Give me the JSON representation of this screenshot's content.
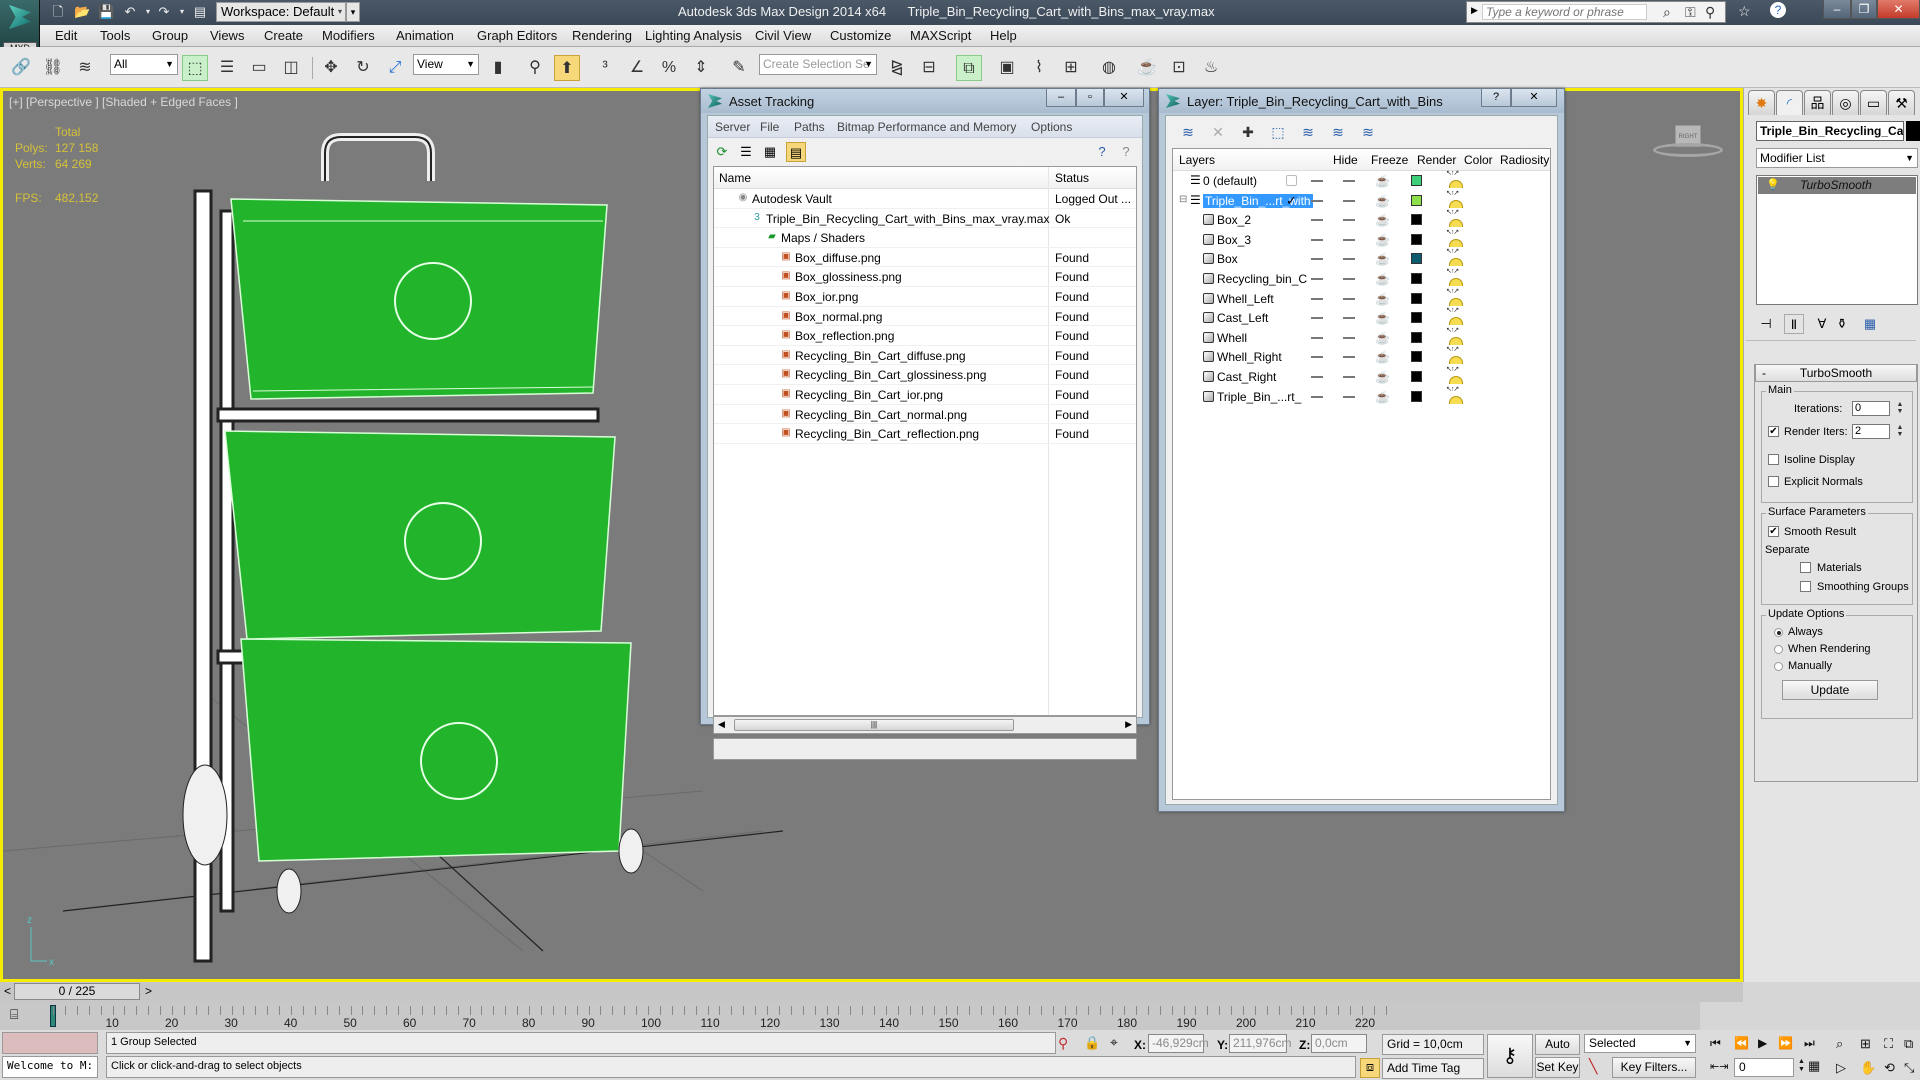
{
  "titlebar": {
    "app_name": "Autodesk 3ds Max Design 2014 x64",
    "file_name": "Triple_Bin_Recycling_Cart_with_Bins_max_vray.max",
    "logo_label": "MXD",
    "workspace": "Workspace: Default",
    "search_placeholder": "Type a keyword or phrase"
  },
  "menubar": [
    "Edit",
    "Tools",
    "Group",
    "Views",
    "Create",
    "Modifiers",
    "Animation",
    "Graph Editors",
    "Rendering",
    "Lighting Analysis",
    "Civil View",
    "Customize",
    "MAXScript",
    "Help"
  ],
  "toolbar": {
    "selection_filter": "All",
    "reference_coord": "View",
    "named_selection_placeholder": "Create Selection Se"
  },
  "viewport": {
    "label": "[+] [Perspective ] [Shaded + Edged Faces ]",
    "stats": {
      "header": "Total",
      "polys_label": "Polys:",
      "polys": "127 158",
      "verts_label": "Verts:",
      "verts": "64 269",
      "fps_label": "FPS:",
      "fps": "482,152"
    },
    "accent_color": "#f5ea00",
    "model_color": "#1fb82a"
  },
  "asset_tracking": {
    "title": "Asset Tracking",
    "menu": [
      "Server",
      "File",
      "Paths",
      "Bitmap Performance and Memory",
      "Options"
    ],
    "columns": [
      "Name",
      "Status"
    ],
    "rows": [
      {
        "name": "Autodesk Vault",
        "status": "Logged Out ...",
        "level": 1,
        "icon": "vault-icon"
      },
      {
        "name": "Triple_Bin_Recycling_Cart_with_Bins_max_vray.max",
        "status": "Ok",
        "level": 2,
        "icon": "max-file-icon"
      },
      {
        "name": "Maps / Shaders",
        "status": "",
        "level": 3,
        "icon": "maps-icon"
      },
      {
        "name": "Box_diffuse.png",
        "status": "Found",
        "level": 4,
        "icon": "bitmap-icon"
      },
      {
        "name": "Box_glossiness.png",
        "status": "Found",
        "level": 4,
        "icon": "bitmap-icon"
      },
      {
        "name": "Box_ior.png",
        "status": "Found",
        "level": 4,
        "icon": "bitmap-icon"
      },
      {
        "name": "Box_normal.png",
        "status": "Found",
        "level": 4,
        "icon": "bitmap-icon"
      },
      {
        "name": "Box_reflection.png",
        "status": "Found",
        "level": 4,
        "icon": "bitmap-icon"
      },
      {
        "name": "Recycling_Bin_Cart_diffuse.png",
        "status": "Found",
        "level": 4,
        "icon": "bitmap-icon"
      },
      {
        "name": "Recycling_Bin_Cart_glossiness.png",
        "status": "Found",
        "level": 4,
        "icon": "bitmap-icon"
      },
      {
        "name": "Recycling_Bin_Cart_ior.png",
        "status": "Found",
        "level": 4,
        "icon": "bitmap-icon"
      },
      {
        "name": "Recycling_Bin_Cart_normal.png",
        "status": "Found",
        "level": 4,
        "icon": "bitmap-icon"
      },
      {
        "name": "Recycling_Bin_Cart_reflection.png",
        "status": "Found",
        "level": 4,
        "icon": "bitmap-icon"
      }
    ]
  },
  "layer_dialog": {
    "title": "Layer: Triple_Bin_Recycling_Cart_with_Bins",
    "columns": [
      "Layers",
      "Hide",
      "Freeze",
      "Render",
      "Color",
      "Radiosity"
    ],
    "rows": [
      {
        "name": "0 (default)",
        "type": "layer",
        "color": "#3dd07a",
        "selected": false,
        "current": false
      },
      {
        "name": "Triple_Bin_...rt_with",
        "type": "layer",
        "color": "#8ee04a",
        "selected": true,
        "current": true
      },
      {
        "name": "Box_2",
        "type": "object",
        "color": "#000000"
      },
      {
        "name": "Box_3",
        "type": "object",
        "color": "#000000"
      },
      {
        "name": "Box",
        "type": "object",
        "color": "#0e5a6e"
      },
      {
        "name": "Recycling_bin_C",
        "type": "object",
        "color": "#000000"
      },
      {
        "name": "Whell_Left",
        "type": "object",
        "color": "#000000"
      },
      {
        "name": "Cast_Left",
        "type": "object",
        "color": "#000000"
      },
      {
        "name": "Whell",
        "type": "object",
        "color": "#000000"
      },
      {
        "name": "Whell_Right",
        "type": "object",
        "color": "#000000"
      },
      {
        "name": "Cast_Right",
        "type": "object",
        "color": "#000000"
      },
      {
        "name": "Triple_Bin_...rt_",
        "type": "object",
        "color": "#000000"
      }
    ]
  },
  "command_panel": {
    "object_name": "Triple_Bin_Recycling_Car",
    "modifier_list": "Modifier List",
    "stack": [
      "TurboSmooth"
    ],
    "rollout": {
      "title": "TurboSmooth",
      "main_group": "Main",
      "iterations_label": "Iterations:",
      "iterations": "0",
      "render_iters_label": "Render Iters:",
      "render_iters": "2",
      "render_iters_checked": true,
      "isoline_label": "Isoline Display",
      "explicit_normals_label": "Explicit Normals",
      "surface_group": "Surface Parameters",
      "smooth_result_label": "Smooth Result",
      "separate_label": "Separate",
      "materials_label": "Materials",
      "smoothing_groups_label": "Smoothing Groups",
      "update_group": "Update Options",
      "always_label": "Always",
      "when_rendering_label": "When Rendering",
      "manually_label": "Manually",
      "update_button": "Update"
    }
  },
  "timeline": {
    "frame": "0 / 225",
    "current": 0,
    "total": 225,
    "ticks": [
      "10",
      "20",
      "30",
      "40",
      "50",
      "60",
      "70",
      "80",
      "90",
      "100",
      "110",
      "120",
      "130",
      "140",
      "150",
      "160",
      "170",
      "180",
      "190",
      "200",
      "210",
      "220"
    ]
  },
  "status": {
    "welcome": "Welcome to M:",
    "selection": "1 Group Selected",
    "prompt": "Click or click-and-drag to select objects",
    "x_label": "X:",
    "x": "-46,929cm",
    "y_label": "Y:",
    "y": "211,976cm",
    "z_label": "Z:",
    "z": "0,0cm",
    "grid": "Grid = 10,0cm",
    "add_time_tag": "Add Time Tag",
    "auto_key": "Auto Key",
    "set_key": "Set Key",
    "key_mode": "Selected",
    "key_filters": "Key Filters...",
    "frame_field": "0"
  }
}
